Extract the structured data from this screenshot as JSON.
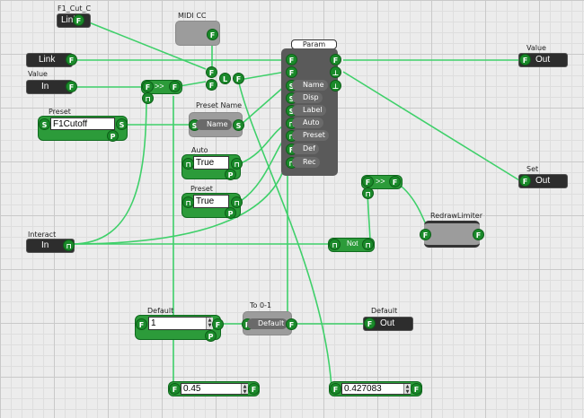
{
  "nodes": {
    "f1_cut_c": {
      "title": "F1_Cut_C",
      "label": "Link"
    },
    "midi_cc": {
      "title": "MIDI CC"
    },
    "link2": {
      "label": "Link"
    },
    "value_in": {
      "title": "Value",
      "label": "In"
    },
    "preset_text": {
      "title": "Preset",
      "value": "F1Cutoff"
    },
    "preset_name": {
      "title": "Preset Name",
      "port": "Name"
    },
    "auto": {
      "title": "Auto",
      "value": "True"
    },
    "preset_bool": {
      "title": "Preset",
      "value": "True"
    },
    "interact": {
      "title": "Interact",
      "label": "In"
    },
    "not_node": {
      "label": "Not"
    },
    "redraw": {
      "title": "RedrawLimiter"
    },
    "param": {
      "title": "Param",
      "ports": [
        "Name",
        "Disp",
        "Label",
        "Auto",
        "Preset",
        "Def",
        "Rec"
      ]
    },
    "value_out": {
      "title": "Value",
      "label": "Out"
    },
    "set_out": {
      "title": "Set",
      "label": "Out"
    },
    "default_in": {
      "title": "Default",
      "value": "1"
    },
    "to01": {
      "title": "To 0-1",
      "port": "Default"
    },
    "default_out": {
      "title": "Default",
      "label": "Out"
    },
    "num_left": {
      "value": "0.45"
    },
    "num_right": {
      "value": "0.427083"
    }
  },
  "pin_letters": {
    "float": "F",
    "string": "S",
    "trigger": "⊓",
    "preset": "P",
    "limit": "L"
  },
  "colors": {
    "wire": "#3fd06a",
    "pin": "#1a8a2a",
    "node_dark": "#2d2d2d",
    "node_gray": "#9c9c9c"
  }
}
